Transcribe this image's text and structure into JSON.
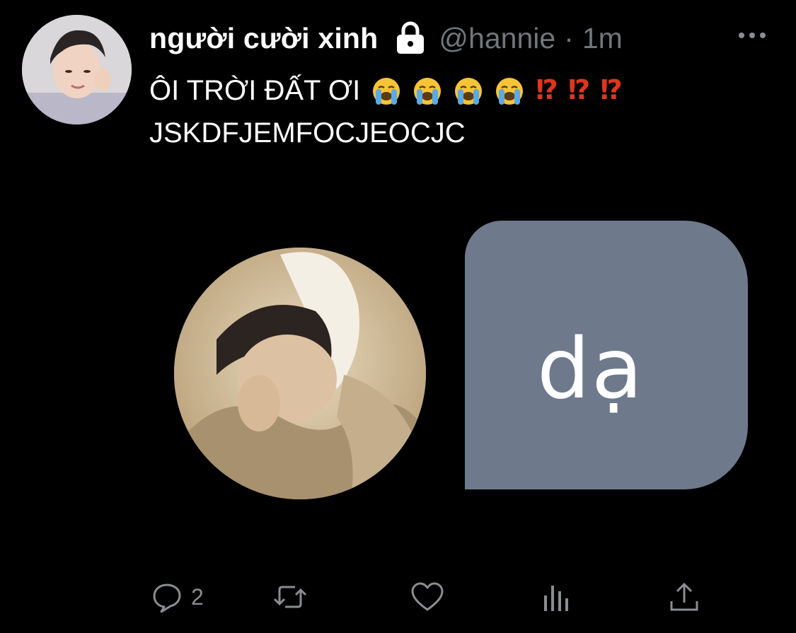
{
  "tweet": {
    "display_name": "người cười xinh",
    "handle": "@hannie",
    "separator": "·",
    "time": "1m",
    "text_line1": "ÔI TRỜI ĐẤT ƠI",
    "interrobangs": [
      "⁉",
      "⁉",
      "⁉"
    ],
    "text_line2": "JSKDFJEMFOCJEOCJC"
  },
  "media": {
    "bubble_text": "dạ"
  },
  "actions": {
    "reply_count": "2"
  },
  "colors": {
    "background": "#000000",
    "secondary_text": "#71767b",
    "bubble": "#6e7a8c",
    "interrobang": "#e0351e"
  },
  "icons": [
    "lock-icon",
    "more-icon",
    "reply-icon",
    "retweet-icon",
    "like-icon",
    "analytics-icon",
    "share-icon",
    "loudly-crying-emoji"
  ]
}
